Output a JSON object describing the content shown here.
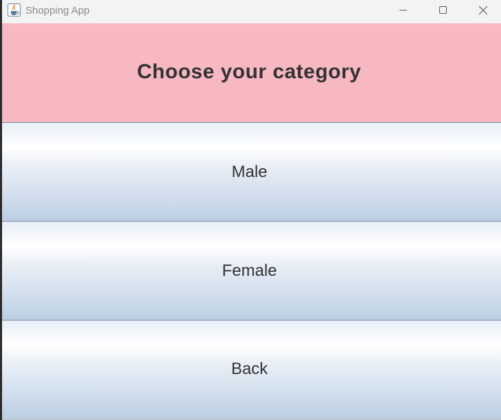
{
  "window": {
    "title": "Shopping App",
    "app_icon": "java-coffee-icon"
  },
  "header": {
    "title": "Choose your category",
    "background": "#f7b8c2"
  },
  "buttons": [
    {
      "id": "male",
      "label": "Male"
    },
    {
      "id": "female",
      "label": "Female"
    },
    {
      "id": "back",
      "label": "Back"
    }
  ],
  "colors": {
    "button_gradient_top": "#ffffff",
    "button_gradient_bottom": "#bccfe4",
    "text": "#333333"
  }
}
